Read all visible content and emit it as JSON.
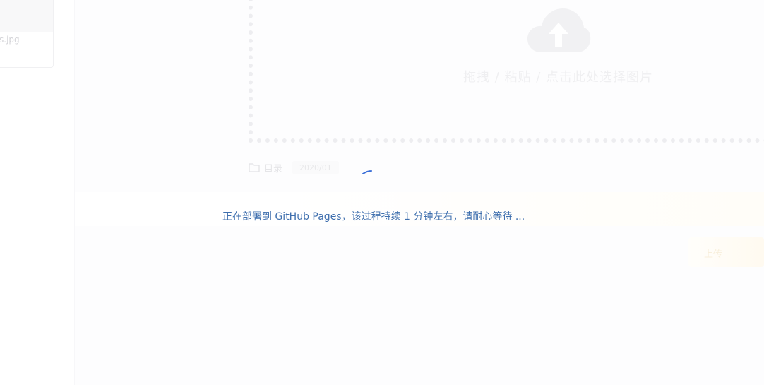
{
  "file_list": {
    "items": [
      {
        "name": "s.jpg"
      }
    ]
  },
  "upload": {
    "hint": "拖拽 / 粘贴 / 点击此处选择图片",
    "icon": "cloud-upload-icon"
  },
  "directory": {
    "label": "目录",
    "badge": "2020/01"
  },
  "deploy": {
    "message": "正在部署到 GitHub Pages，该过程持续 1 分钟左右，请耐心等待 ..."
  },
  "actions": {
    "ghost_button_label": "上传"
  },
  "colors": {
    "message_text": "#3f6fae",
    "spinner": "#3b6fd8"
  }
}
